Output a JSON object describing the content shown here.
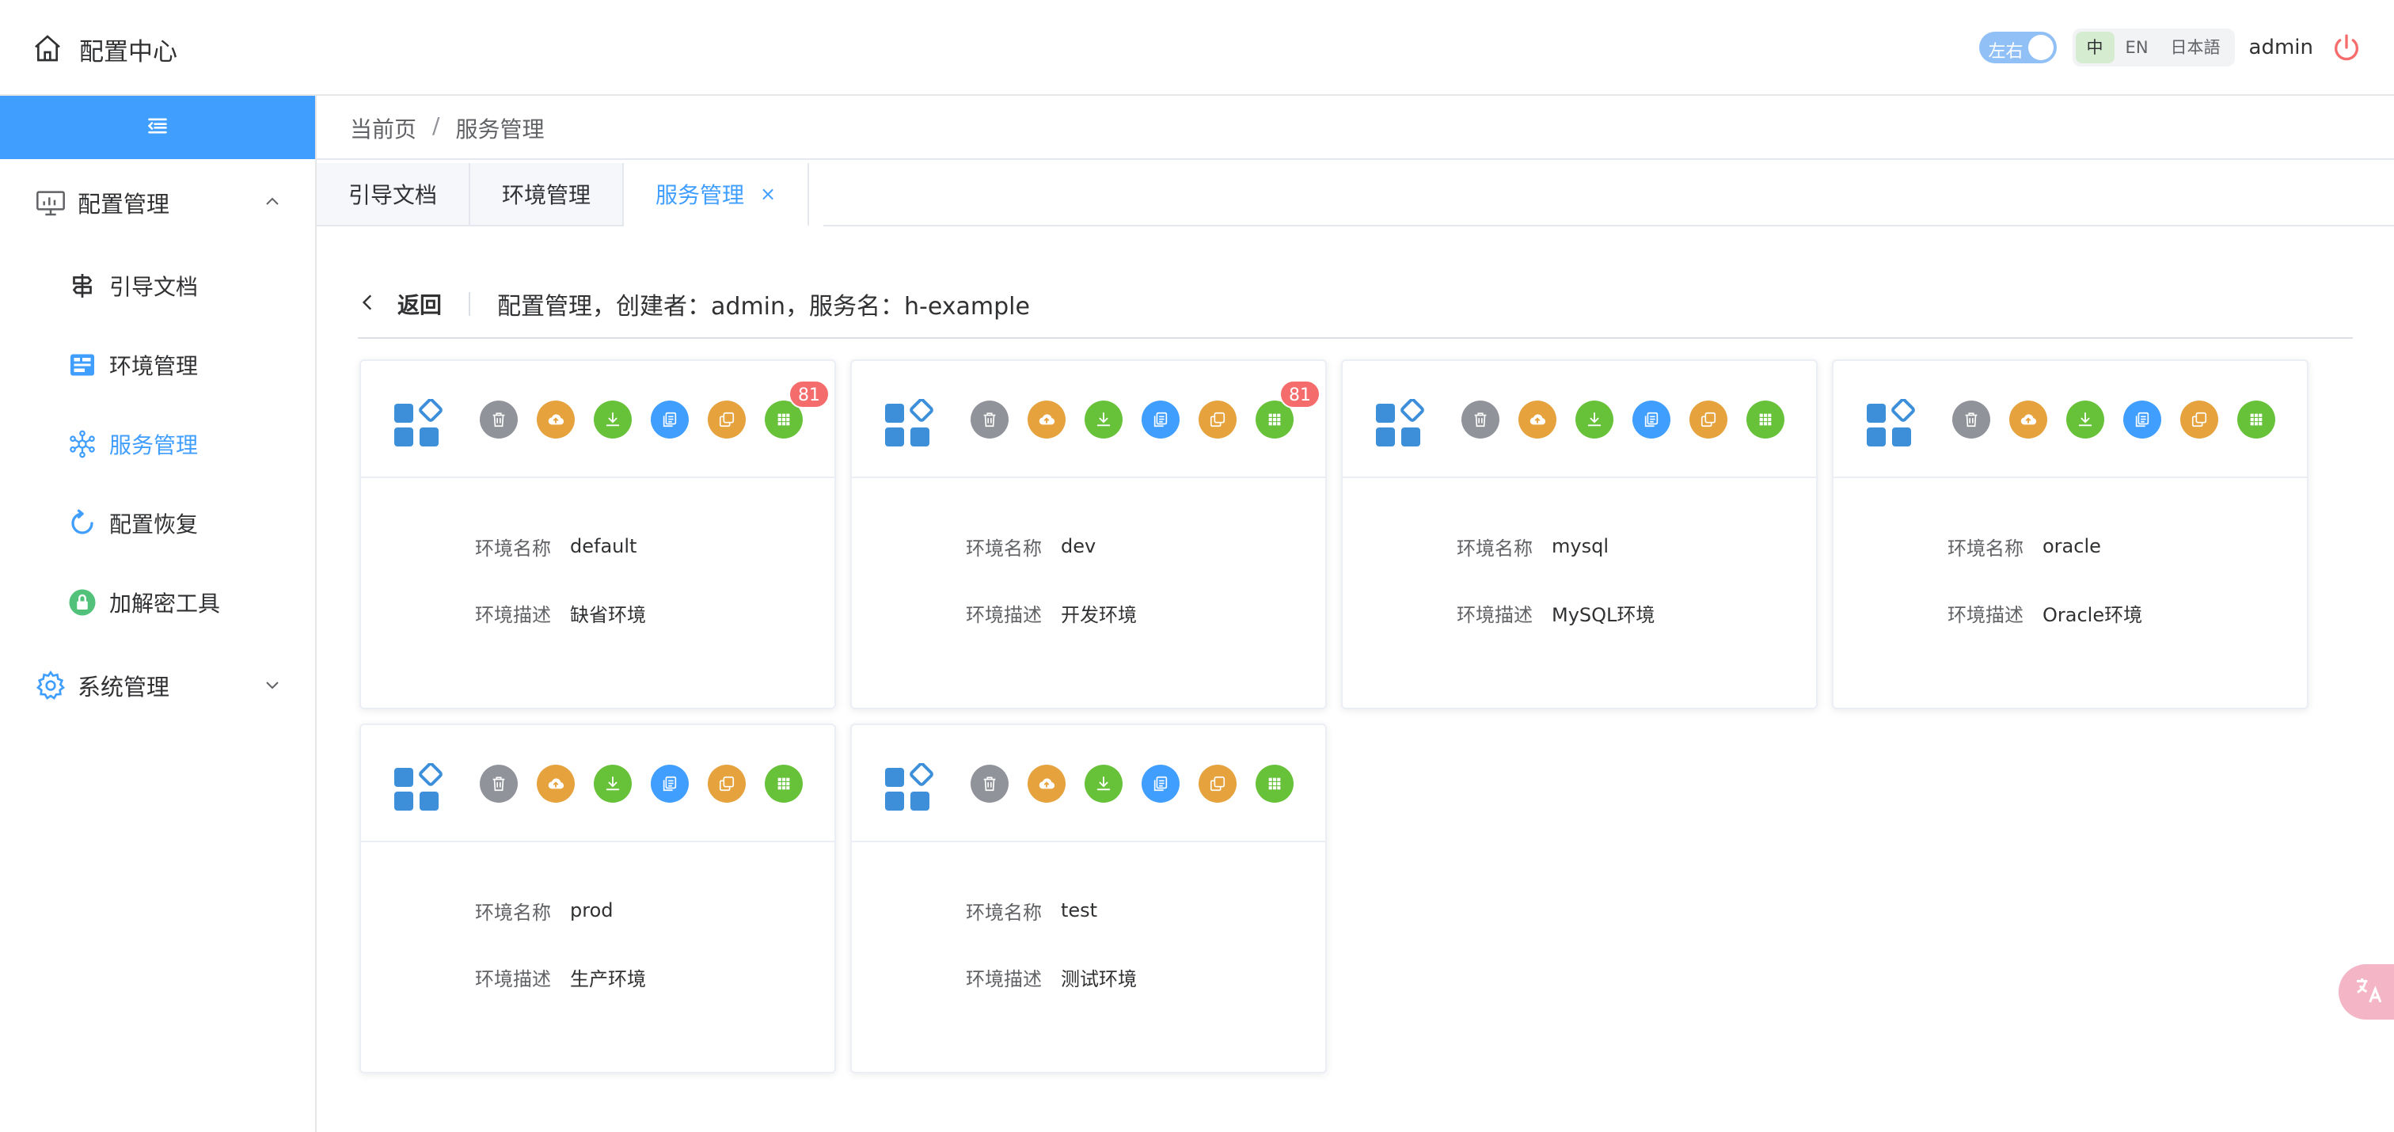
{
  "app": {
    "title": "配置中心"
  },
  "header": {
    "layout_toggle_label": "左右",
    "languages": [
      "中",
      "EN",
      "日本語"
    ],
    "active_language": "中",
    "user": "admin"
  },
  "sidebar": {
    "groups": [
      {
        "label": "配置管理",
        "expanded": true,
        "items": [
          {
            "label": "引导文档",
            "icon": "signpost-icon",
            "active": false
          },
          {
            "label": "环境管理",
            "icon": "env-icon",
            "active": false
          },
          {
            "label": "服务管理",
            "icon": "service-network-icon",
            "active": true
          },
          {
            "label": "配置恢复",
            "icon": "restore-icon",
            "active": false
          },
          {
            "label": "加解密工具",
            "icon": "lock-icon",
            "active": false
          }
        ]
      },
      {
        "label": "系统管理",
        "expanded": false,
        "items": []
      }
    ]
  },
  "breadcrumb": {
    "root": "当前页",
    "separator": "/",
    "current": "服务管理"
  },
  "tabs": [
    {
      "label": "引导文档",
      "active": false
    },
    {
      "label": "环境管理",
      "active": false
    },
    {
      "label": "服务管理",
      "active": true,
      "close": "×"
    }
  ],
  "page": {
    "back_label": "返回",
    "description": "配置管理，创建者：admin，服务名：h-example"
  },
  "card_fields": {
    "name_label": "环境名称",
    "desc_label": "环境描述"
  },
  "cards": [
    {
      "name": "default",
      "desc": "缺省环境",
      "badge": "81"
    },
    {
      "name": "dev",
      "desc": "开发环境",
      "badge": "81"
    },
    {
      "name": "mysql",
      "desc": "MySQL环境",
      "badge": null
    },
    {
      "name": "oracle",
      "desc": "Oracle环境",
      "badge": null
    },
    {
      "name": "prod",
      "desc": "生产环境",
      "badge": null
    },
    {
      "name": "test",
      "desc": "测试环境",
      "badge": null
    }
  ],
  "colors": {
    "accent": "#409eff",
    "gray": "#909399",
    "orange": "#e6a23c",
    "green": "#67c23a",
    "badge": "#f56c6c",
    "power": "#f56c6c"
  }
}
